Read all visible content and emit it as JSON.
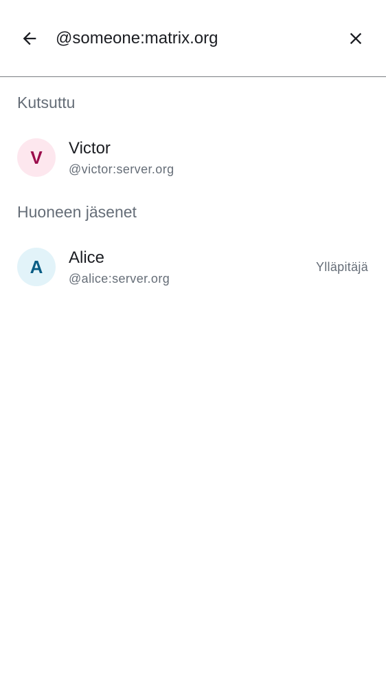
{
  "search": {
    "value": "@someone:matrix.org",
    "back_icon": "arrow-back-icon",
    "clear_icon": "close-icon"
  },
  "sections": {
    "invited": {
      "title": "Kutsuttu",
      "members": [
        {
          "name": "Victor",
          "user_id": "@victor:server.org",
          "avatar_initial": "V",
          "avatar_bg": "#fde7ee",
          "avatar_fg": "#9b0b4b"
        }
      ]
    },
    "room_members": {
      "title": "Huoneen jäsenet",
      "members": [
        {
          "name": "Alice",
          "user_id": "@alice:server.org",
          "avatar_initial": "A",
          "avatar_bg": "#e2f3f9",
          "avatar_fg": "#085c84",
          "role": "Ylläpitäjä"
        }
      ]
    }
  }
}
